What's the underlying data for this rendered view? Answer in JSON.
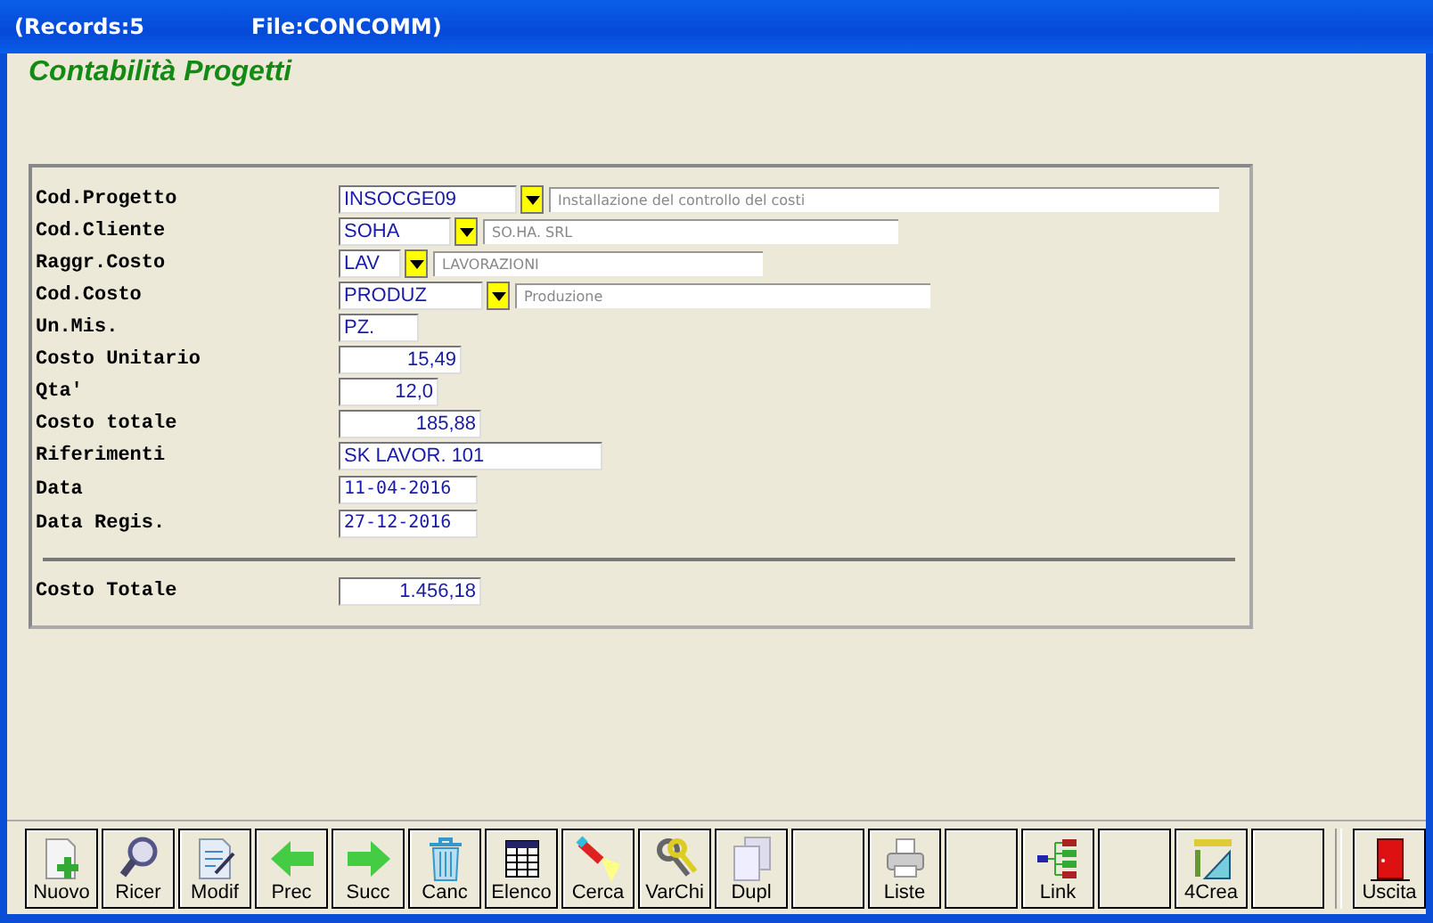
{
  "window": {
    "title_records": "(Records:5",
    "title_file": "File:CONCOMM)"
  },
  "heading": "Contabilità Progetti",
  "fields": [
    {
      "label": "Cod.Progetto",
      "kind": "combo",
      "value": "INSOCGE09",
      "description": "Installazione del controllo del costi"
    },
    {
      "label": "Cod.Cliente",
      "kind": "combo",
      "value": "SOHA",
      "description": "SO.HA. SRL"
    },
    {
      "label": "Raggr.Costo",
      "kind": "combo",
      "value": "LAV",
      "description": "LAVORAZIONI"
    },
    {
      "label": "Cod.Costo",
      "kind": "combo",
      "value": "PRODUZ",
      "description": "Produzione"
    },
    {
      "label": "Un.Mis.",
      "kind": "text",
      "value": "PZ."
    },
    {
      "label": "Costo Unitario",
      "kind": "number",
      "value": "15,49"
    },
    {
      "label": "Qta'",
      "kind": "number",
      "value": "12,0"
    },
    {
      "label": "Costo totale",
      "kind": "number",
      "value": "185,88"
    },
    {
      "label": "Riferimenti",
      "kind": "text",
      "value": "SK LAVOR. 101"
    },
    {
      "label": "Data",
      "kind": "date",
      "value": "11-04-2016"
    },
    {
      "label": "Data Regis.",
      "kind": "date",
      "value": "27-12-2016"
    }
  ],
  "total": {
    "label": "Costo Totale",
    "value": "1.456,18"
  },
  "toolbar": [
    {
      "kind": "new",
      "label": "Nuovo"
    },
    {
      "kind": "find",
      "label": "Ricer"
    },
    {
      "kind": "edit",
      "label": "Modif"
    },
    {
      "kind": "prev",
      "label": "Prec"
    },
    {
      "kind": "next",
      "label": "Succ"
    },
    {
      "kind": "delete",
      "label": "Canc"
    },
    {
      "kind": "list",
      "label": "Elenco"
    },
    {
      "kind": "torch",
      "label": "Cerca"
    },
    {
      "kind": "keys",
      "label": "VarChi"
    },
    {
      "kind": "copy",
      "label": "Dupl"
    },
    {
      "kind": "empty"
    },
    {
      "kind": "print",
      "label": "Liste"
    },
    {
      "kind": "empty"
    },
    {
      "kind": "link",
      "label": "Link"
    },
    {
      "kind": "empty"
    },
    {
      "kind": "ruler",
      "label": "4Crea"
    },
    {
      "kind": "empty"
    },
    {
      "kind": "exit",
      "label": "Uscita"
    }
  ]
}
